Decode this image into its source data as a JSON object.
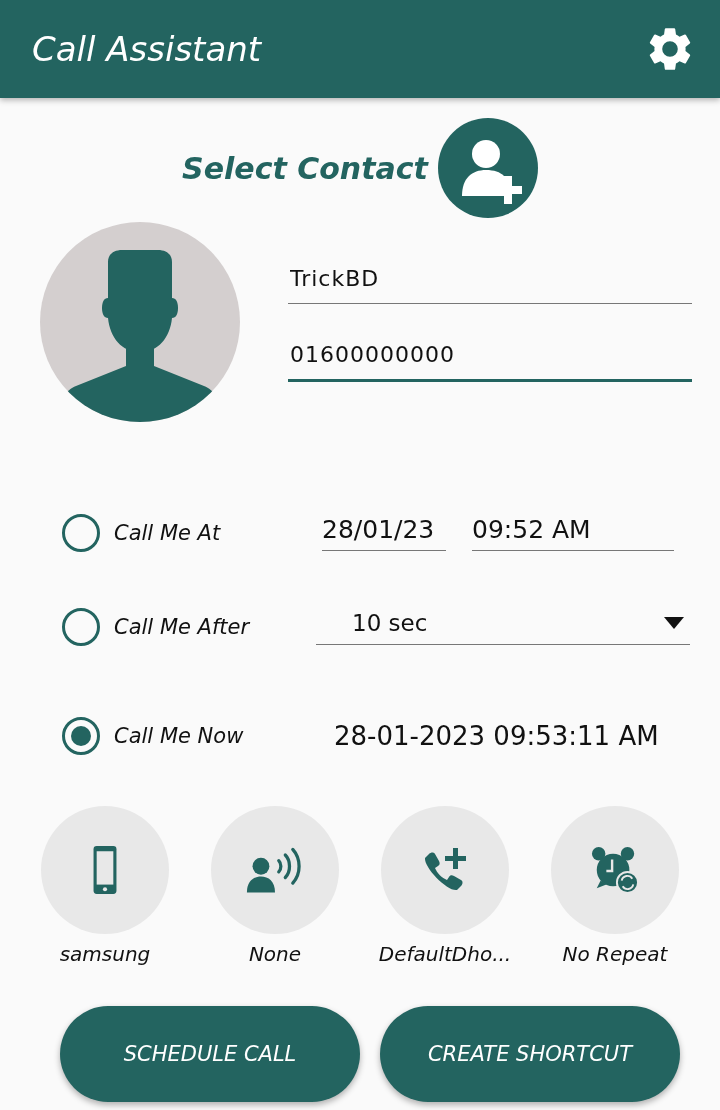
{
  "app_bar": {
    "title": "Call Assistant"
  },
  "select_contact": {
    "label": "Select Contact"
  },
  "contact_fields": [
    {
      "value": "TrickBD",
      "focused": false
    },
    {
      "value": "01600000000",
      "focused": true
    }
  ],
  "schedule_options": [
    {
      "kind": "datetime",
      "label": "Call Me At",
      "selected": false,
      "date": "28/01/23",
      "time": "09:52 AM"
    },
    {
      "kind": "dropdown",
      "label": "Call Me After",
      "selected": false,
      "value": "10 sec"
    },
    {
      "kind": "now",
      "label": "Call Me Now",
      "selected": true,
      "timestamp": "28-01-2023 09:53:11 AM"
    }
  ],
  "shortcuts": [
    {
      "kind": "phone",
      "label": "samsung"
    },
    {
      "kind": "voice",
      "label": "None"
    },
    {
      "kind": "add_call",
      "label": "DefaultDho..."
    },
    {
      "kind": "alarm",
      "label": "No Repeat"
    }
  ],
  "buttons": [
    "SCHEDULE CALL",
    "CREATE SHORTCUT"
  ]
}
